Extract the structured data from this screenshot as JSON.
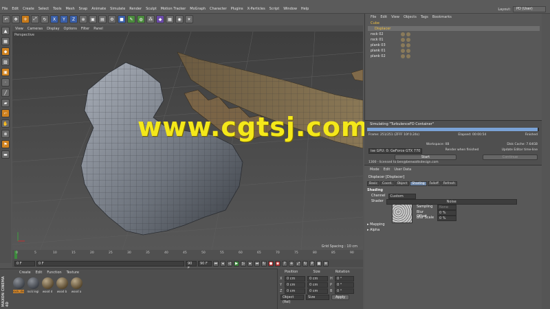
{
  "menubar": {
    "items": [
      "File",
      "Edit",
      "Create",
      "Select",
      "Tools",
      "Mesh",
      "Snap",
      "Animate",
      "Simulate",
      "Render",
      "Sculpt",
      "Motion Tracker",
      "MoGraph",
      "Character",
      "Plugins",
      "X-Particles",
      "Script",
      "Window",
      "Help"
    ],
    "layout_label": "Layout:",
    "layout_value": "PD (User)"
  },
  "viewport": {
    "menu": [
      "View",
      "Cameras",
      "Display",
      "Options",
      "Filter",
      "Panel"
    ],
    "label": "Perspective",
    "grid_spacing": "Grid Spacing : 10 cm",
    "watermark": "www.cgtsj.com"
  },
  "timeline": {
    "ticks": [
      "0",
      "5",
      "10",
      "15",
      "20",
      "25",
      "30",
      "35",
      "40",
      "45",
      "50",
      "55",
      "60",
      "65",
      "70",
      "75",
      "80",
      "85",
      "90"
    ],
    "current_frame": "0 F",
    "start_field": "0 F",
    "end_field": "90 F",
    "end_field2": "90 F",
    "right_field": "0 F"
  },
  "material_manager": {
    "menu": [
      "Create",
      "Edit",
      "Function",
      "Texture"
    ],
    "brand": "MAXON CINEMA 4D",
    "materials": [
      {
        "label": "rock_dis",
        "selected": true,
        "kind": "rock"
      },
      {
        "label": "rock legi",
        "selected": false,
        "kind": "rock"
      },
      {
        "label": "wood d",
        "selected": false,
        "kind": "wood"
      },
      {
        "label": "wood b",
        "selected": false,
        "kind": "wood"
      },
      {
        "label": "wood a",
        "selected": false,
        "kind": "wood"
      }
    ]
  },
  "coordinates": {
    "headers": [
      "Position",
      "Size",
      "Rotation"
    ],
    "rows": [
      {
        "axis": "X",
        "pos": "0 cm",
        "size": "0 cm",
        "rot_axis": "H",
        "rot": "0 °"
      },
      {
        "axis": "Y",
        "pos": "0 cm",
        "size": "0 cm",
        "rot_axis": "P",
        "rot": "0 °"
      },
      {
        "axis": "Z",
        "pos": "0 cm",
        "size": "0 cm",
        "rot_axis": "B",
        "rot": "0 °"
      }
    ],
    "mode": "Object (Rel)",
    "size_mode": "Size",
    "apply": "Apply"
  },
  "object_manager": {
    "menu": [
      "File",
      "Edit",
      "View",
      "Objects",
      "Tags",
      "Bookmarks"
    ],
    "objects": [
      {
        "name": "Cube",
        "highlight": true,
        "selected": false
      },
      {
        "name": "Displacer",
        "highlight": true,
        "selected": true
      },
      {
        "name": "rock 02",
        "highlight": false,
        "selected": false
      },
      {
        "name": "rock 01",
        "highlight": false,
        "selected": false
      },
      {
        "name": "plank 03",
        "highlight": false,
        "selected": false
      },
      {
        "name": "plank 01",
        "highlight": false,
        "selected": false
      },
      {
        "name": "plank 02",
        "highlight": false,
        "selected": false
      }
    ]
  },
  "simulation": {
    "title": "Simulating \"TurbulenceFD Container\"",
    "progress": 0.99,
    "frame": "Frame: 251/251 (ZFFF 10f 0.24s)",
    "elapsed": "Elapsed: 00:00:54",
    "finished": "Finished",
    "workspace": "Workspace: 0B",
    "disk_cache": "Disk Cache: 7.64GB",
    "gpu": "ise GPU: 0: GeForce GTX 770",
    "render_finished": "Render when finished",
    "update_editor": "Update Editor time-line",
    "start": "Start",
    "continue": "Continue",
    "license": "1300 - licensed to ben@benwattsdesign.com"
  },
  "attributes": {
    "menu": [
      "Mode",
      "Edit",
      "User Data"
    ],
    "title": "Displacer [Displacer]",
    "tabs": [
      "Basic",
      "Coord.",
      "Object",
      "Shading",
      "Falloff",
      "Refresh"
    ],
    "active_tab": "Shading",
    "section": "Shading",
    "channel_label": "Channel",
    "channel_value": "Custom Shader",
    "shader_label": "Shader",
    "shader_value": "Noise",
    "sampling_label": "Sampling",
    "sampling_value": "None",
    "blur_offset_label": "Blur Offset",
    "blur_offset_value": "0 %",
    "blur_scale_label": "Blur Scale",
    "blur_scale_value": "0 %",
    "mapping": "Mapping",
    "alpha": "Alpha"
  }
}
